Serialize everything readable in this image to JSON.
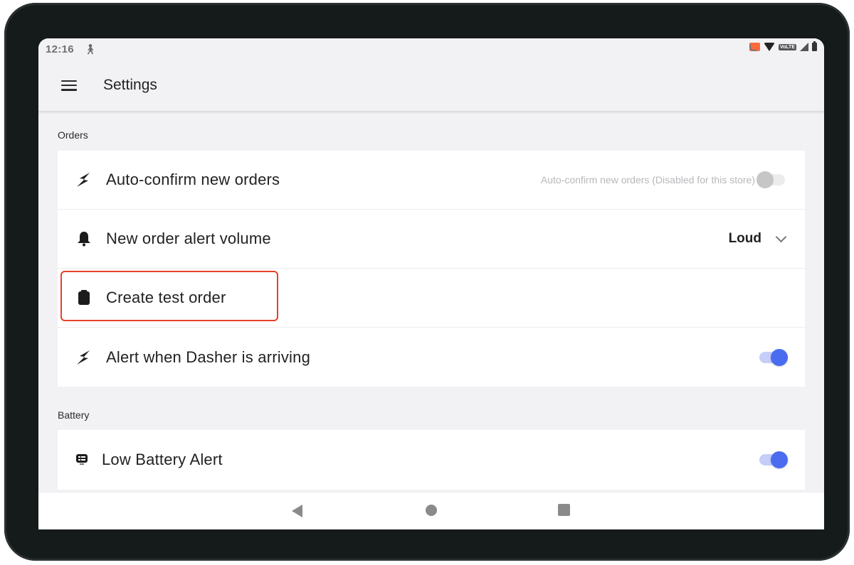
{
  "status_bar": {
    "time": "12:16",
    "left_icons": [
      "accessibility-run-icon"
    ],
    "right_icons": [
      "cast-icon",
      "wifi-icon",
      "volte-icon",
      "signal-icon",
      "battery-icon"
    ],
    "volte_label": "VoLTE"
  },
  "app_bar": {
    "menu_icon": "hamburger-menu-icon",
    "title": "Settings"
  },
  "sections": [
    {
      "label": "Orders",
      "rows": [
        {
          "icon": "lightning-icon",
          "label": "Auto-confirm new orders",
          "control": "toggle",
          "toggle_on": false,
          "disabled": true,
          "hint": "Auto-confirm new orders (Disabled for this store)"
        },
        {
          "icon": "bell-icon",
          "label": "New order alert volume",
          "control": "dropdown",
          "value": "Loud"
        },
        {
          "icon": "clipboard-icon",
          "label": "Create test order",
          "control": "none",
          "highlighted": true
        },
        {
          "icon": "lightning-icon",
          "label": "Alert when Dasher is arriving",
          "control": "toggle",
          "toggle_on": true
        }
      ]
    },
    {
      "label": "Battery",
      "rows": [
        {
          "icon": "battery-alert-icon",
          "label": "Low Battery Alert",
          "control": "toggle",
          "toggle_on": true
        }
      ]
    }
  ],
  "nav_bar": {
    "buttons": [
      "back",
      "home",
      "recents"
    ]
  },
  "colors": {
    "accent": "#4a6cf0",
    "highlight_border": "#e8412a",
    "background": "#f2f2f5"
  }
}
